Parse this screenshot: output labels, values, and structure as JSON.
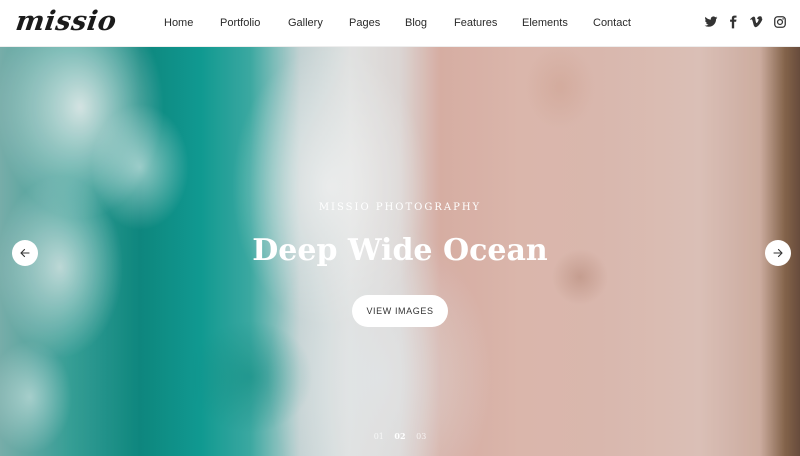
{
  "brand": {
    "logo_text": "missio"
  },
  "nav": {
    "items": [
      {
        "label": "Home"
      },
      {
        "label": "Portfolio"
      },
      {
        "label": "Gallery"
      },
      {
        "label": "Pages"
      },
      {
        "label": "Blog"
      },
      {
        "label": "Features"
      },
      {
        "label": "Elements"
      },
      {
        "label": "Contact"
      }
    ]
  },
  "social": {
    "icons": [
      "twitter-icon",
      "facebook-icon",
      "vimeo-icon",
      "instagram-icon"
    ]
  },
  "hero": {
    "eyebrow": "MISSIO PHOTOGRAPHY",
    "title": "Deep Wide Ocean",
    "cta_label": "VIEW IMAGES"
  },
  "slider": {
    "pagination": [
      "01",
      "02",
      "03"
    ],
    "active_index": 1
  },
  "colors": {
    "text_dark": "#2a2a2a",
    "hero_text": "#ffffff",
    "button_bg": "#ffffff"
  }
}
